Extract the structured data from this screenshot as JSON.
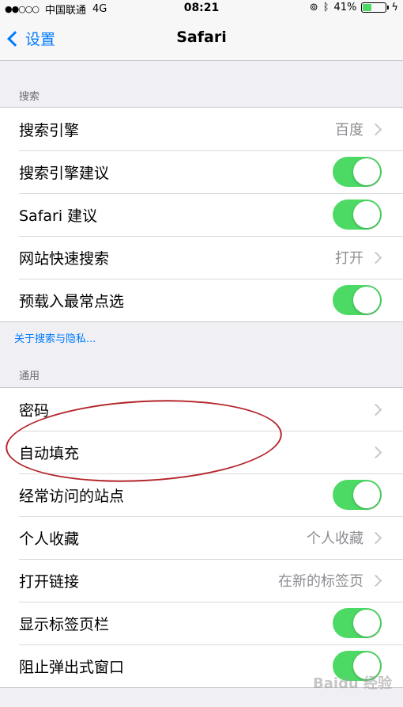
{
  "status_bar": {
    "signal": "●●○○○",
    "carrier": "中国联通",
    "network": "4G",
    "time": "08:21",
    "battery": "41%",
    "battery_level": 0.41
  },
  "nav": {
    "back_label": "设置",
    "title": "Safari"
  },
  "search_section": {
    "header": "搜索",
    "rows": [
      {
        "label": "搜索引擎",
        "detail": "百度"
      },
      {
        "label": "搜索引擎建议",
        "toggle": true
      },
      {
        "label": "Safari 建议",
        "toggle": true
      },
      {
        "label": "网站快速搜索",
        "detail": "打开"
      },
      {
        "label": "预载入最常点选",
        "toggle": true
      }
    ],
    "footer_link": "关于搜索与隐私..."
  },
  "general_section": {
    "header": "通用",
    "rows": [
      {
        "label": "密码"
      },
      {
        "label": "自动填充"
      },
      {
        "label": "经常访问的站点",
        "toggle": true
      },
      {
        "label": "个人收藏",
        "detail": "个人收藏"
      },
      {
        "label": "打开链接",
        "detail": "在新的标签页"
      },
      {
        "label": "显示标签页栏",
        "toggle": true
      },
      {
        "label": "阻止弹出式窗口",
        "toggle": true
      }
    ]
  },
  "watermark": "Baidu 经验",
  "colors": {
    "accent": "#007aff",
    "toggle_on": "#4cd964",
    "annotation": "#b3262b"
  }
}
